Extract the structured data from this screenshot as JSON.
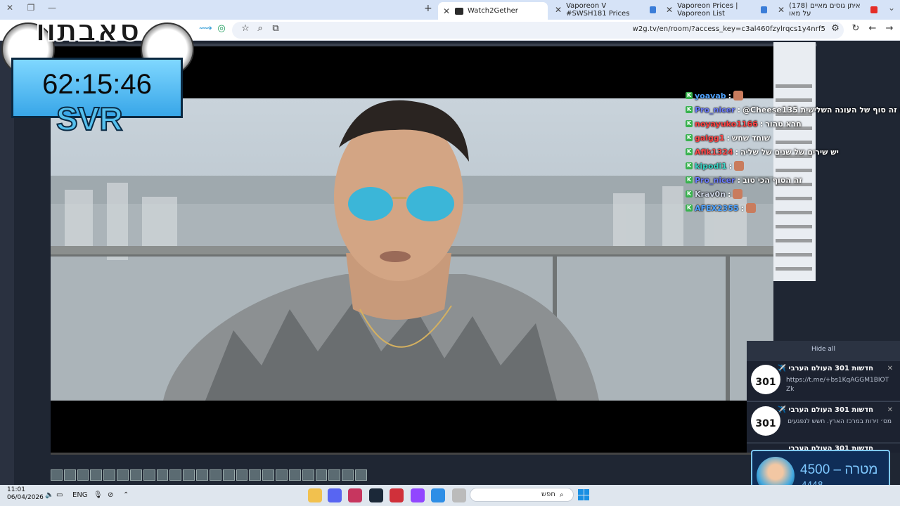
{
  "browser": {
    "tabs": [
      {
        "label": "Watch2Gether",
        "active": true
      },
      {
        "label": "Vaporeon V #SWSH181 Prices",
        "active": false
      },
      {
        "label": "Vaporeon Prices | Vaporeon List",
        "active": false
      },
      {
        "label": "(178) איתן גוסים מאיים על מאו",
        "active": false
      }
    ],
    "url": "w2g.tv/en/room/?access_key=c3al460fzylrqcs1y4nrf5"
  },
  "overlay": {
    "logo_text": "סאבתוו",
    "timer": "62:15:46",
    "timer_label": "SVR"
  },
  "chat": [
    {
      "user": "yoavab",
      "color": "#4fa3ff",
      "msg": ""
    },
    {
      "user": "Pro_nicer",
      "color": "#6b7bff",
      "msg": "@Cheese135 פתוח זה סוף של העונה השלישית"
    },
    {
      "user": "noyayuko1166",
      "color": "#ff4040",
      "msg": "חרא טהור"
    },
    {
      "user": "galgg1",
      "color": "#ff4a4a",
      "msg": "שוחד שחש"
    },
    {
      "user": "Afik1324",
      "color": "#ff4a4a",
      "msg": "יש שירים של שנים של שליה"
    },
    {
      "user": "kipodi1",
      "color": "#3ad4c4",
      "msg": ""
    },
    {
      "user": "Pro_nicer",
      "color": "#6b7bff",
      "msg": "זה הסוף הכי טוב"
    },
    {
      "user": "Krav0n",
      "color": "#cfd6e6",
      "msg": ""
    },
    {
      "user": "AFEX2355",
      "color": "#4fa3ff",
      "msg": ""
    }
  ],
  "notifications": {
    "hide_all": "Hide all",
    "items": [
      {
        "title": "חדשות 301 העולם הערבי ✈️",
        "body": "https://t.me/+bs1KqAGGM1BIOTZk",
        "icon_text": "301"
      },
      {
        "title": "חדשות 301 העולם הערבי ✈️",
        "body": "מס׳ זירות במרכז הארץ. חשש לנפגעים",
        "icon_text": "301"
      },
      {
        "title": "חדשות 301 העולם הערבי",
        "body": "",
        "icon_text": "301"
      }
    ]
  },
  "goal": {
    "label": "4500 – מטרה",
    "current": "4448"
  },
  "taskbar": {
    "time": "11:01",
    "date": "06/04/2026",
    "lang": "ENG",
    "search_placeholder": "חפש"
  },
  "colors": {
    "accent": "#7ec8ff",
    "chat_badge": "#37b24d"
  }
}
